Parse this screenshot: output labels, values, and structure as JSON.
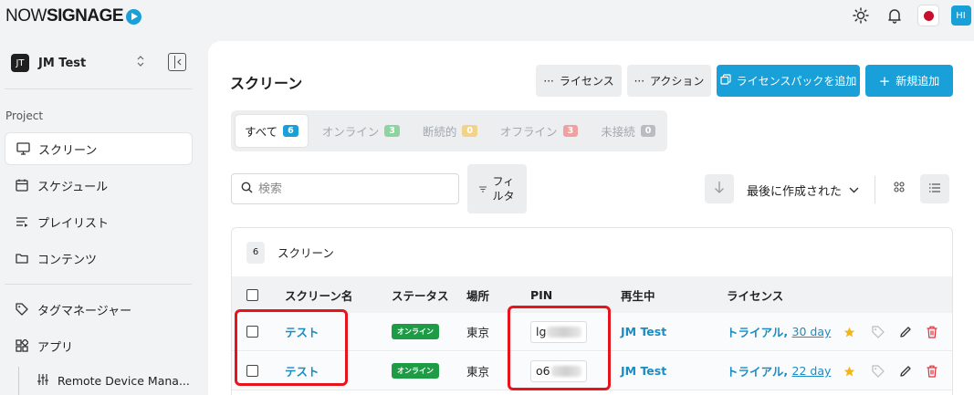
{
  "brand": {
    "logo_part1": "NOW",
    "logo_part2": "SIGNAGE"
  },
  "topbar": {
    "avatar_initials": "HI"
  },
  "workspace": {
    "initials": "JT",
    "name": "JM Test"
  },
  "sidebar": {
    "section_label": "Project",
    "items": [
      {
        "label": "スクリーン"
      },
      {
        "label": "スケジュール"
      },
      {
        "label": "プレイリスト"
      },
      {
        "label": "コンテンツ"
      },
      {
        "label": "タグマネージャー"
      },
      {
        "label": "アプリ"
      }
    ],
    "sub_item": "Remote Device Mana..."
  },
  "page": {
    "title": "スクリーン"
  },
  "toolbar": {
    "license": "ライセンス",
    "action": "アクション",
    "add_license_pack": "ライセンスパックを追加",
    "add_new": "新規追加"
  },
  "tabs": [
    {
      "label": "すべて",
      "count": "6",
      "color": "#1aa0d8"
    },
    {
      "label": "オンライン",
      "count": "3",
      "color": "#8fd3a0"
    },
    {
      "label": "断続的",
      "count": "0",
      "color": "#f1d48a"
    },
    {
      "label": "オフライン",
      "count": "3",
      "color": "#f0a0a0"
    },
    {
      "label": "未接続",
      "count": "0",
      "color": "#b9bdc2"
    }
  ],
  "search": {
    "placeholder": "検索"
  },
  "filter": {
    "label_line1": "フィ",
    "label_line2": "ルタ"
  },
  "sort": {
    "label": "最後に作成された"
  },
  "table": {
    "count": "6",
    "count_label": "スクリーン",
    "headers": [
      "スクリーン名",
      "ステータス",
      "場所",
      "PIN",
      "再生中",
      "ライセンス"
    ],
    "rows": [
      {
        "name": "テスト",
        "status": "オンライン",
        "location": "東京",
        "pin_prefix": "lg",
        "playing": "JM Test",
        "license_type": "トライアル",
        "license_days": "30 day"
      },
      {
        "name": "テスト",
        "status": "オンライン",
        "location": "東京",
        "pin_prefix": "o6",
        "playing": "JM Test",
        "license_type": "トライアル",
        "license_days": "22 day"
      }
    ]
  }
}
